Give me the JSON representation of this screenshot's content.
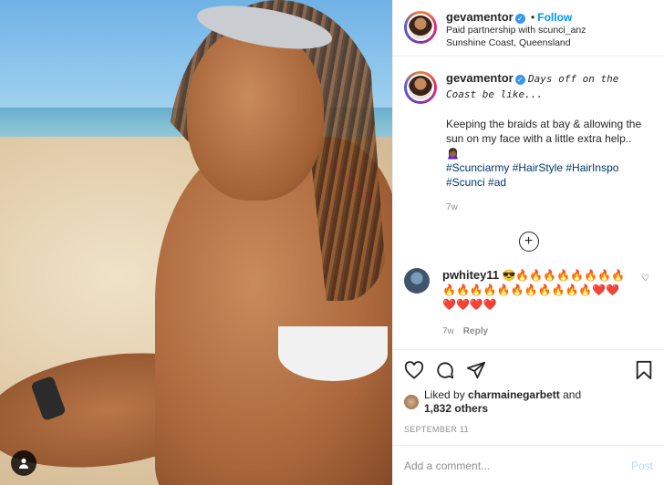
{
  "header": {
    "username": "gevamentor",
    "follow_label": "Follow",
    "dot": "•",
    "partnership_prefix": "Paid partnership with",
    "partner": "scunci_anz",
    "location": "Sunshine Coast, Queensland"
  },
  "caption": {
    "username": "gevamentor",
    "headline": "Days off on the Coast be like...",
    "body": "Keeping the braids at bay & allowing the sun on my face with a little extra help.. 🙍🏾‍♀️",
    "hashtags": "#Scunciarmy #HairStyle #HairInspo #Scunci #ad",
    "time": "7w"
  },
  "reply": {
    "username": "pwhitey11",
    "text": "😎🔥🔥🔥🔥🔥🔥🔥🔥🔥🔥🔥🔥🔥🔥🔥🔥🔥🔥🔥❤️❤️❤️❤️❤️❤️",
    "time": "7w",
    "reply_label": "Reply"
  },
  "likes": {
    "prefix": "Liked by",
    "user": "charmainegarbett",
    "and": "and",
    "others": "1,832 others"
  },
  "date": "SEPTEMBER 11",
  "add_comment": {
    "placeholder": "Add a comment...",
    "post_label": "Post"
  },
  "icons": {
    "verified": "verified-badge-icon",
    "load_more": "plus-circle-icon",
    "like": "heart-icon",
    "comment": "comment-icon",
    "share": "paper-plane-icon",
    "save": "bookmark-icon",
    "tag": "user-tag-icon"
  },
  "colors": {
    "link": "#0095f6",
    "hashtag": "#00376b",
    "muted": "#8e8e8e"
  }
}
